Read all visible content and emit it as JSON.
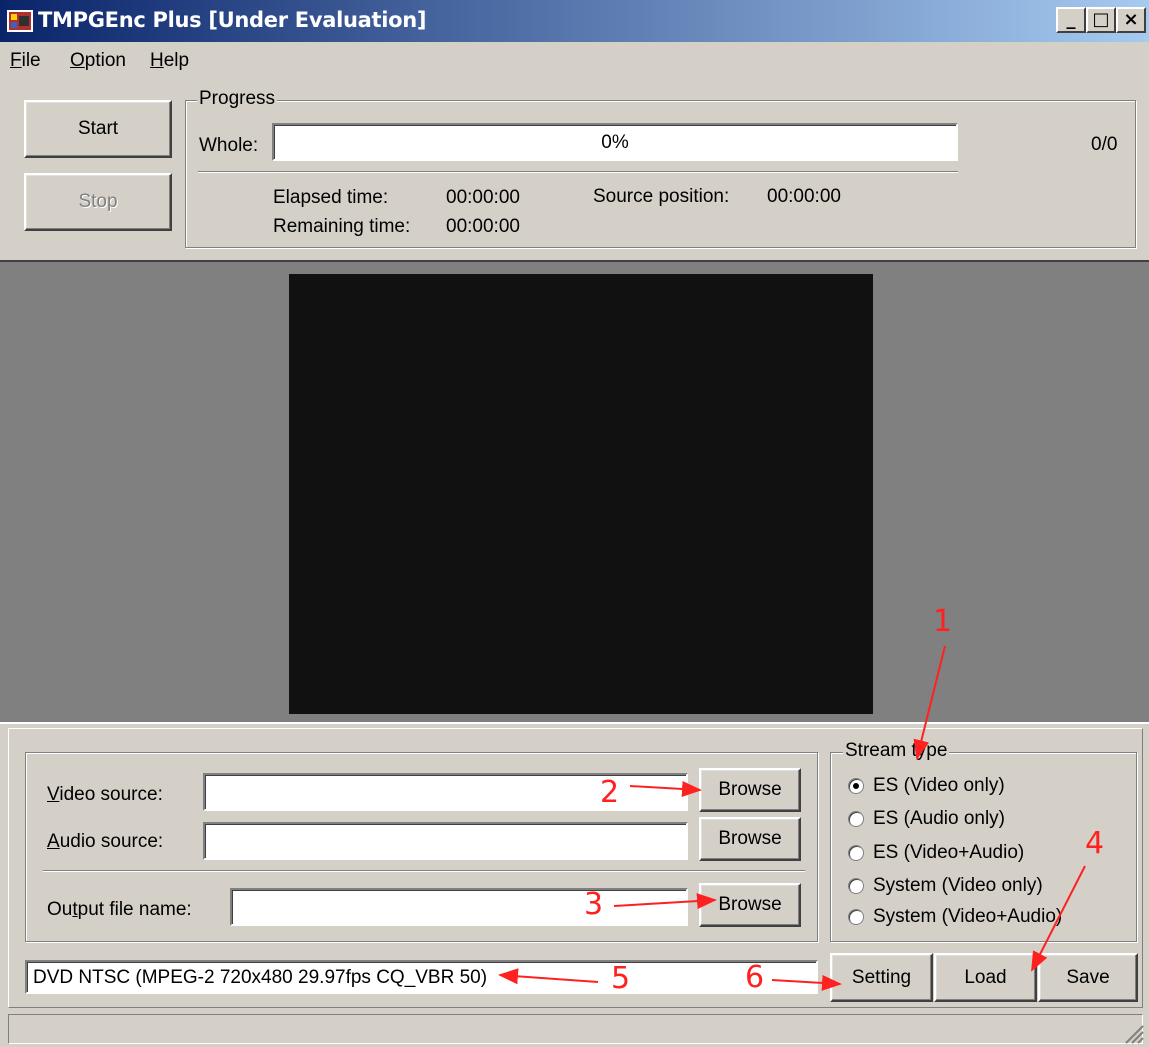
{
  "window": {
    "title": "TMPGEnc Plus [Under Evaluation]"
  },
  "title_buttons": {
    "minimize": "_",
    "maximize": "□",
    "close": "×"
  },
  "menu": {
    "items": [
      {
        "label": "File",
        "mnemonic": "F",
        "rest": "ile"
      },
      {
        "label": "Option",
        "mnemonic": "O",
        "rest": "ption"
      },
      {
        "label": "Help",
        "mnemonic": "H",
        "rest": "elp"
      }
    ]
  },
  "controls": {
    "start_label": "Start",
    "stop_label": "Stop"
  },
  "progress": {
    "group_title": "Progress",
    "whole_label": "Whole:",
    "whole_percent": "0%",
    "whole_value": 0,
    "count": "0/0",
    "elapsed_label": "Elapsed time:",
    "elapsed_value": "00:00:00",
    "remaining_label": "Remaining time:",
    "remaining_value": "00:00:00",
    "source_position_label": "Source position:",
    "source_position_value": "00:00:00"
  },
  "sources": {
    "video_label": {
      "mnemonic": "V",
      "rest": "ideo source:"
    },
    "audio_label": {
      "mnemonic": "A",
      "rest": "udio source:"
    },
    "output_label": {
      "pre": "Ou",
      "mnemonic": "t",
      "rest": "put file name:"
    },
    "video_value": "",
    "audio_value": "",
    "output_value": "",
    "browse_label": "Browse"
  },
  "stream_type": {
    "group_title": "Stream type",
    "options": [
      {
        "label": "ES (Video only)",
        "selected": true
      },
      {
        "label": "ES (Audio only)",
        "selected": false
      },
      {
        "label": "ES (Video+Audio)",
        "selected": false
      },
      {
        "label": "System (Video only)",
        "selected": false
      },
      {
        "label": "System (Video+Audio)",
        "selected": false
      }
    ]
  },
  "template": {
    "value": "DVD NTSC (MPEG-2 720x480 29.97fps CQ_VBR 50)"
  },
  "bottom_buttons": {
    "setting": "Setting",
    "load": "Load",
    "save": "Save"
  },
  "annotations": [
    "1",
    "2",
    "3",
    "4",
    "5",
    "6"
  ],
  "colors": {
    "annotation": "#ff2020",
    "titlebar_start": "#0a246a",
    "titlebar_end": "#a6caf0",
    "window_bg": "#d4d0c8"
  }
}
